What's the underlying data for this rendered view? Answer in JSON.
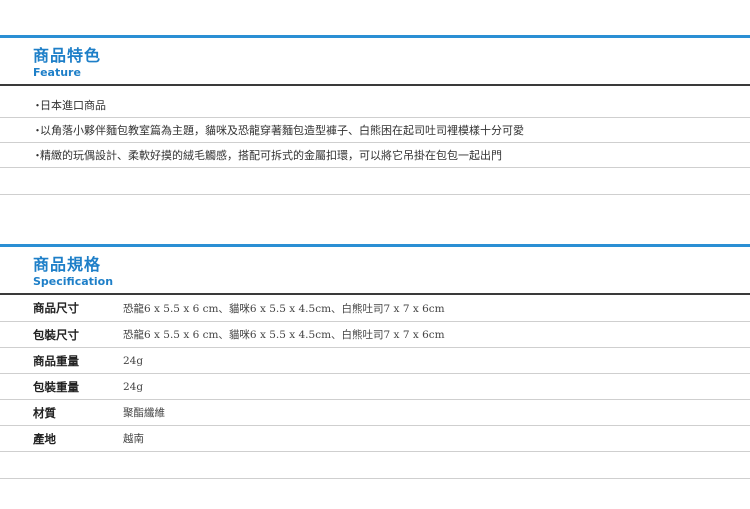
{
  "feature": {
    "title_zh": "商品特色",
    "title_en": "Feature",
    "bullet": "・",
    "items": [
      "日本進口商品",
      "以角落小夥伴麵包教室篇為主題，貓咪及恐龍穿著麵包造型褲子、白熊困在起司吐司裡模樣十分可愛",
      "精緻的玩偶設計、柔軟好摸的絨毛觸感，搭配可拆式的金屬扣環，可以將它吊掛在包包一起出門"
    ]
  },
  "spec": {
    "title_zh": "商品規格",
    "title_en": "Specification",
    "rows": [
      {
        "key": "商品尺寸",
        "value": "恐龍6 x 5.5 x 6 cm、貓咪6 x 5.5 x 4.5cm、白熊吐司7 x 7 x 6cm"
      },
      {
        "key": "包裝尺寸",
        "value": "恐龍6 x 5.5 x 6 cm、貓咪6 x 5.5 x 4.5cm、白熊吐司7 x 7 x 6cm"
      },
      {
        "key": "商品重量",
        "value": "24g"
      },
      {
        "key": "包裝重量",
        "value": "24g"
      },
      {
        "key": "材質",
        "value": "聚酯纖維"
      },
      {
        "key": "產地",
        "value": "越南"
      }
    ]
  },
  "colors": {
    "accent": "#1e7fc8",
    "topbar": "#2a8fd4",
    "divider": "#3a3a3a",
    "rowline": "#cfcfcf"
  }
}
